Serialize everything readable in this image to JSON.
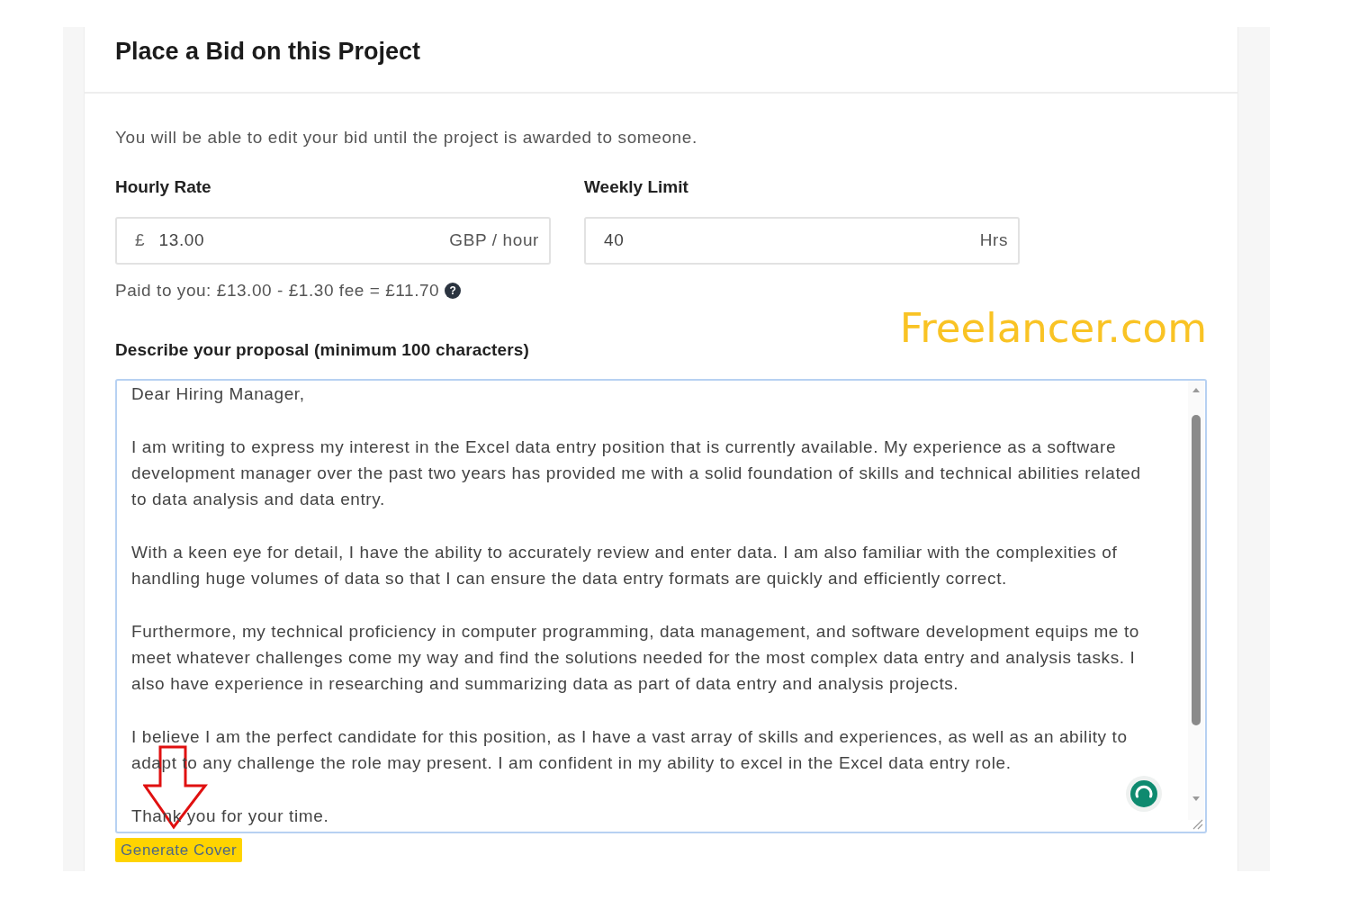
{
  "card": {
    "title": "Place a Bid on this Project"
  },
  "notice": "You will be able to edit your bid until the project is awarded to someone.",
  "fields": [
    {
      "label": "Hourly Rate",
      "prefix": "£",
      "value": "13.00",
      "suffix": "GBP / hour"
    },
    {
      "label": "Weekly Limit",
      "value": "40",
      "suffix": "Hrs"
    }
  ],
  "fee_note": {
    "text": "Paid to you: £13.00 - £1.30 fee = £11.70",
    "help_icon": "?"
  },
  "annotation": {
    "label": "Freelancer.com"
  },
  "proposal": {
    "label": "Describe your proposal (minimum 100 characters)",
    "focused": true,
    "paragraphs": [
      {
        "lines": [
          "Dear Hiring Manager,"
        ]
      },
      {
        "lines": [
          "I am writing to express my interest in the Excel data entry position that is currently available. My experience as a software",
          "development manager over the past two years has provided me with a solid foundation of skills and technical abilities related",
          "to data analysis and data entry."
        ]
      },
      {
        "lines": [
          "With a keen eye for detail, I have the ability to accurately review and enter data. I am also familiar with the complexities of",
          "handling huge volumes of data so that I can ensure the data entry formats are quickly and efficiently correct."
        ]
      },
      {
        "lines": [
          "Furthermore, my technical proficiency in computer programming, data management, and software development equips me to",
          "meet whatever challenges come my way and find the solutions needed for the most complex data entry and analysis tasks. I",
          "also have experience in researching and summarizing data as part of data entry and analysis projects."
        ]
      },
      {
        "lines": [
          "I believe I am the perfect candidate for this position, as I have a vast array of skills and experiences, as well as an ability to",
          "adapt to any challenge the role may present. I am confident in my ability to excel in the Excel data entry role."
        ]
      },
      {
        "lines": [
          "Thank you for your time."
        ]
      }
    ]
  },
  "generate_button": {
    "label": "Generate Cover"
  }
}
